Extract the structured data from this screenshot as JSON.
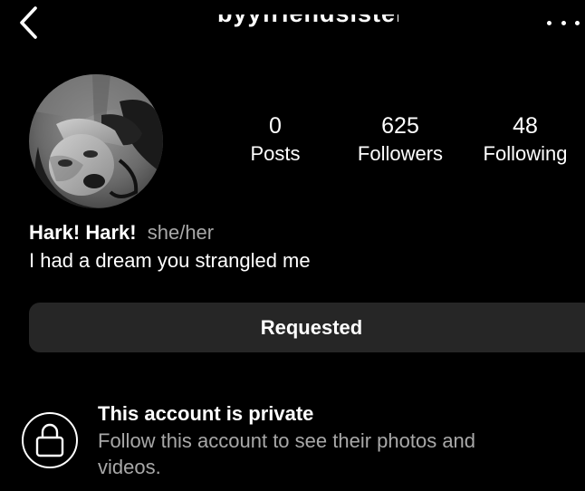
{
  "header": {
    "username": "byyfriendsister",
    "back_icon": "chevron-left-icon",
    "more_icon": "ellipsis-icon"
  },
  "profile": {
    "avatar_icon": "profile-photo",
    "stats": {
      "posts": {
        "count": "0",
        "label": "Posts"
      },
      "followers": {
        "count": "625",
        "label": "Followers"
      },
      "following": {
        "count": "48",
        "label": "Following"
      }
    },
    "name": "Hark! Hark!",
    "pronouns": "she/her",
    "bio": "I had a dream you strangled me"
  },
  "actions": {
    "follow_status_label": "Requested"
  },
  "private_notice": {
    "icon": "lock-icon",
    "title": "This account is private",
    "subtitle": "Follow this account to see their photos and videos."
  },
  "colors": {
    "background": "#000000",
    "button_bg": "#262626",
    "text_primary": "#ffffff",
    "text_secondary": "#a8a8a8"
  }
}
